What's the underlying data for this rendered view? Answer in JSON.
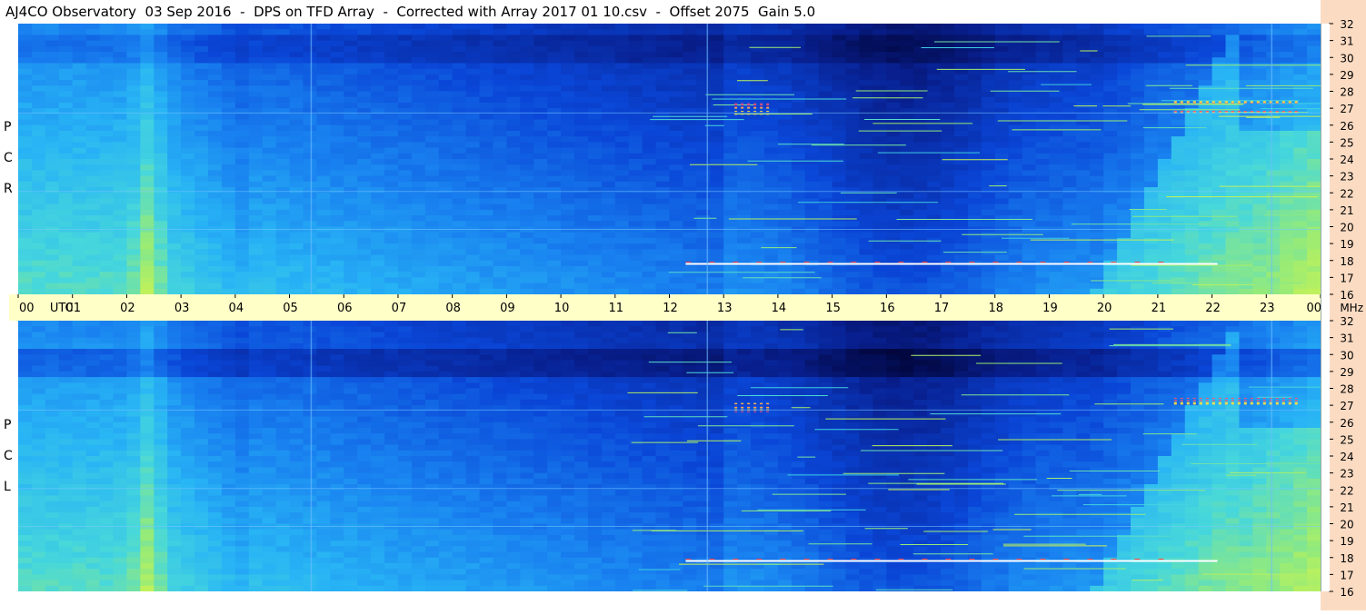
{
  "title": "AJ4CO Observatory  03 Sep 2016  -  DPS on TFD Array  -  Corrected with Array 2017 01 10.csv  -  Offset 2075  Gain 5.0",
  "panels": {
    "top_label_letters": [
      "R",
      "C",
      "P"
    ],
    "bottom_label_letters": [
      "L",
      "C",
      "P"
    ]
  },
  "chart_data": {
    "type": "heatmap",
    "title": "AJ4CO Observatory  03 Sep 2016  -  DPS on TFD Array  -  Corrected with Array 2017 01 10.csv  -  Offset 2075  Gain 5.0",
    "x_axis": {
      "unit_label": "UTC",
      "range": [
        0,
        24
      ],
      "tick_labels": [
        "00",
        "01",
        "02",
        "03",
        "04",
        "05",
        "06",
        "07",
        "08",
        "09",
        "10",
        "11",
        "12",
        "13",
        "14",
        "15",
        "16",
        "17",
        "18",
        "19",
        "20",
        "21",
        "22",
        "23",
        "00"
      ]
    },
    "y_axis": {
      "unit_label": "MHz",
      "range": [
        16,
        32
      ],
      "tick_labels": [
        "16",
        "17",
        "18",
        "19",
        "20",
        "21",
        "22",
        "23",
        "24",
        "25",
        "26",
        "27",
        "28",
        "29",
        "30",
        "31",
        "32"
      ]
    },
    "series": [
      {
        "name": "RCP"
      },
      {
        "name": "LCP"
      }
    ],
    "colors": {
      "background_level": "#1e8cf0",
      "quiet_low_level": "#0a3cc8",
      "darkest": "#000040",
      "bright_noise": "#b4f05a",
      "hot": "#ff4040",
      "axis_bar": "#ffffc8",
      "right_axis": "#fbdcc3"
    }
  }
}
